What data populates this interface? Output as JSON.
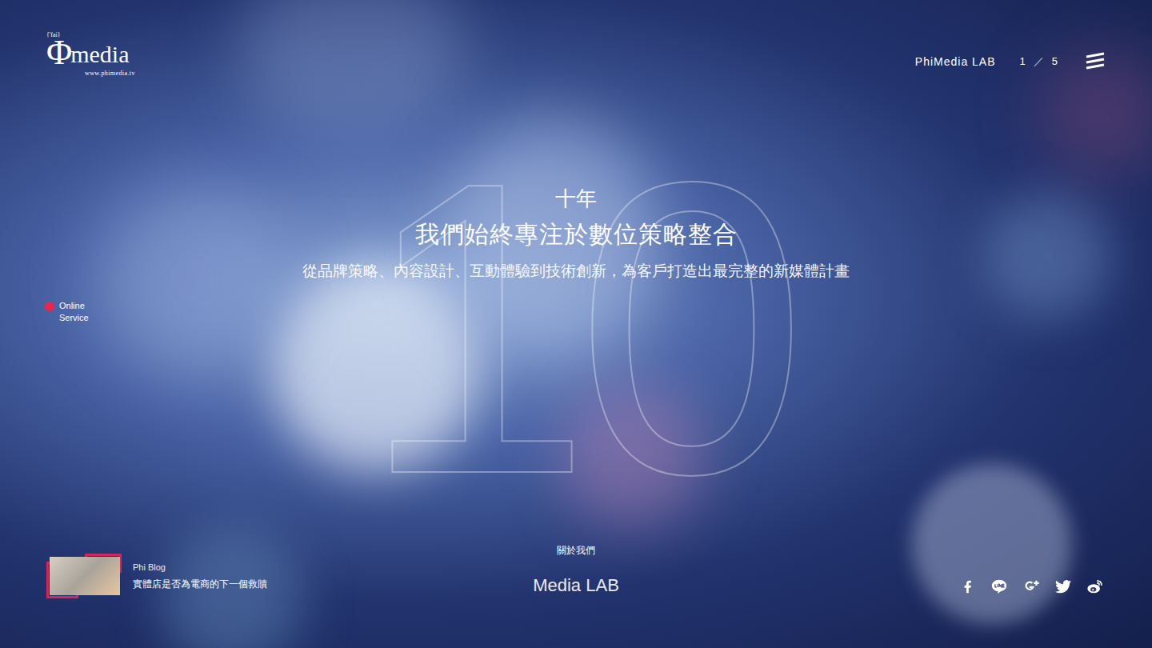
{
  "logo": {
    "phonetic": "{'fai}",
    "symbol": "Φ",
    "name": "media",
    "url": "www.phimedia.tv"
  },
  "header": {
    "title": "PhiMedia LAB",
    "pager": {
      "current": "1",
      "separator": "／",
      "total": "5"
    }
  },
  "online_service": {
    "label": "Online Service"
  },
  "hero": {
    "number": "10",
    "kicker": "十年",
    "headline": "我們始終專注於數位策略整合",
    "subline": "從品牌策略、內容設計、互動體驗到技術創新，為客戶打造出最完整的新媒體計畫"
  },
  "section": {
    "caption": "關於我們",
    "title": "Media LAB"
  },
  "blog": {
    "label": "Phi Blog",
    "title": "實體店是否為電商的下一個救贖"
  }
}
